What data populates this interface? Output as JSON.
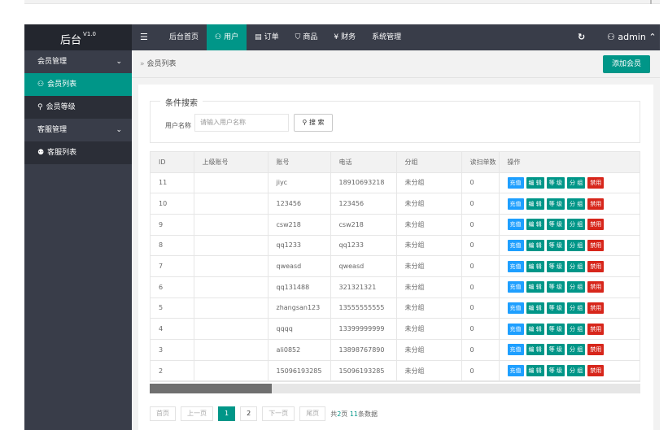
{
  "brand": {
    "name": "后台",
    "version": "V1.0"
  },
  "topnav": {
    "items": [
      {
        "label": "后台首页",
        "icon": "",
        "active": false
      },
      {
        "label": "用户",
        "icon": "user-icon",
        "active": true
      },
      {
        "label": "订单",
        "icon": "order-icon",
        "active": false
      },
      {
        "label": "商品",
        "icon": "cart-icon",
        "active": false
      },
      {
        "label": "财务",
        "icon": "yen-icon",
        "active": false
      },
      {
        "label": "系统管理",
        "icon": "",
        "active": false
      }
    ],
    "user": "admin"
  },
  "sidebar": {
    "group1": "会员管理",
    "item_member_list": "会员列表",
    "item_member_level": "会员等级",
    "group2": "客服管理",
    "item_service_list": "客服列表"
  },
  "breadcrumb": {
    "current": "会员列表"
  },
  "add_button": "添加会员",
  "search": {
    "legend": "条件搜索",
    "label": "用户名称",
    "placeholder": "请输入用户名称",
    "button": "搜 索"
  },
  "table": {
    "columns": [
      "ID",
      "上级账号",
      "账号",
      "电话",
      "分组",
      "读扫单数",
      "操作"
    ],
    "actions": [
      "充值",
      "编 辑",
      "等 级",
      "分 组",
      "禁用"
    ],
    "rows": [
      [
        "11",
        "",
        "jiyc",
        "18910693218",
        "未分组",
        "0"
      ],
      [
        "10",
        "",
        "123456",
        "123456",
        "未分组",
        "0"
      ],
      [
        "9",
        "",
        "csw218",
        "csw218",
        "未分组",
        "0"
      ],
      [
        "8",
        "",
        "qq1233",
        "qq1233",
        "未分组",
        "0"
      ],
      [
        "7",
        "",
        "qweasd",
        "qweasd",
        "未分组",
        "0"
      ],
      [
        "6",
        "",
        "qq131488",
        "321321321",
        "未分组",
        "0"
      ],
      [
        "5",
        "",
        "zhangsan123",
        "13555555555",
        "未分组",
        "0"
      ],
      [
        "4",
        "",
        "qqqq",
        "13399999999",
        "未分组",
        "0"
      ],
      [
        "3",
        "",
        "ali0852",
        "13898767890",
        "未分组",
        "0"
      ],
      [
        "2",
        "",
        "15096193285",
        "15096193285",
        "未分组",
        "0"
      ]
    ]
  },
  "pager": {
    "first": "首页",
    "prev": "上一页",
    "pages": [
      "1",
      "2"
    ],
    "current": "1",
    "next": "下一页",
    "last": "尾页",
    "total_prefix": "共",
    "total_pages": "2",
    "total_mid": "页 ",
    "total_count": "11",
    "total_suffix": "条数据"
  },
  "colors": {
    "accent": "#009688",
    "header": "#393d49",
    "brand_bg": "#23262e",
    "blue": "#1e9fff",
    "danger": "#d7261b"
  }
}
